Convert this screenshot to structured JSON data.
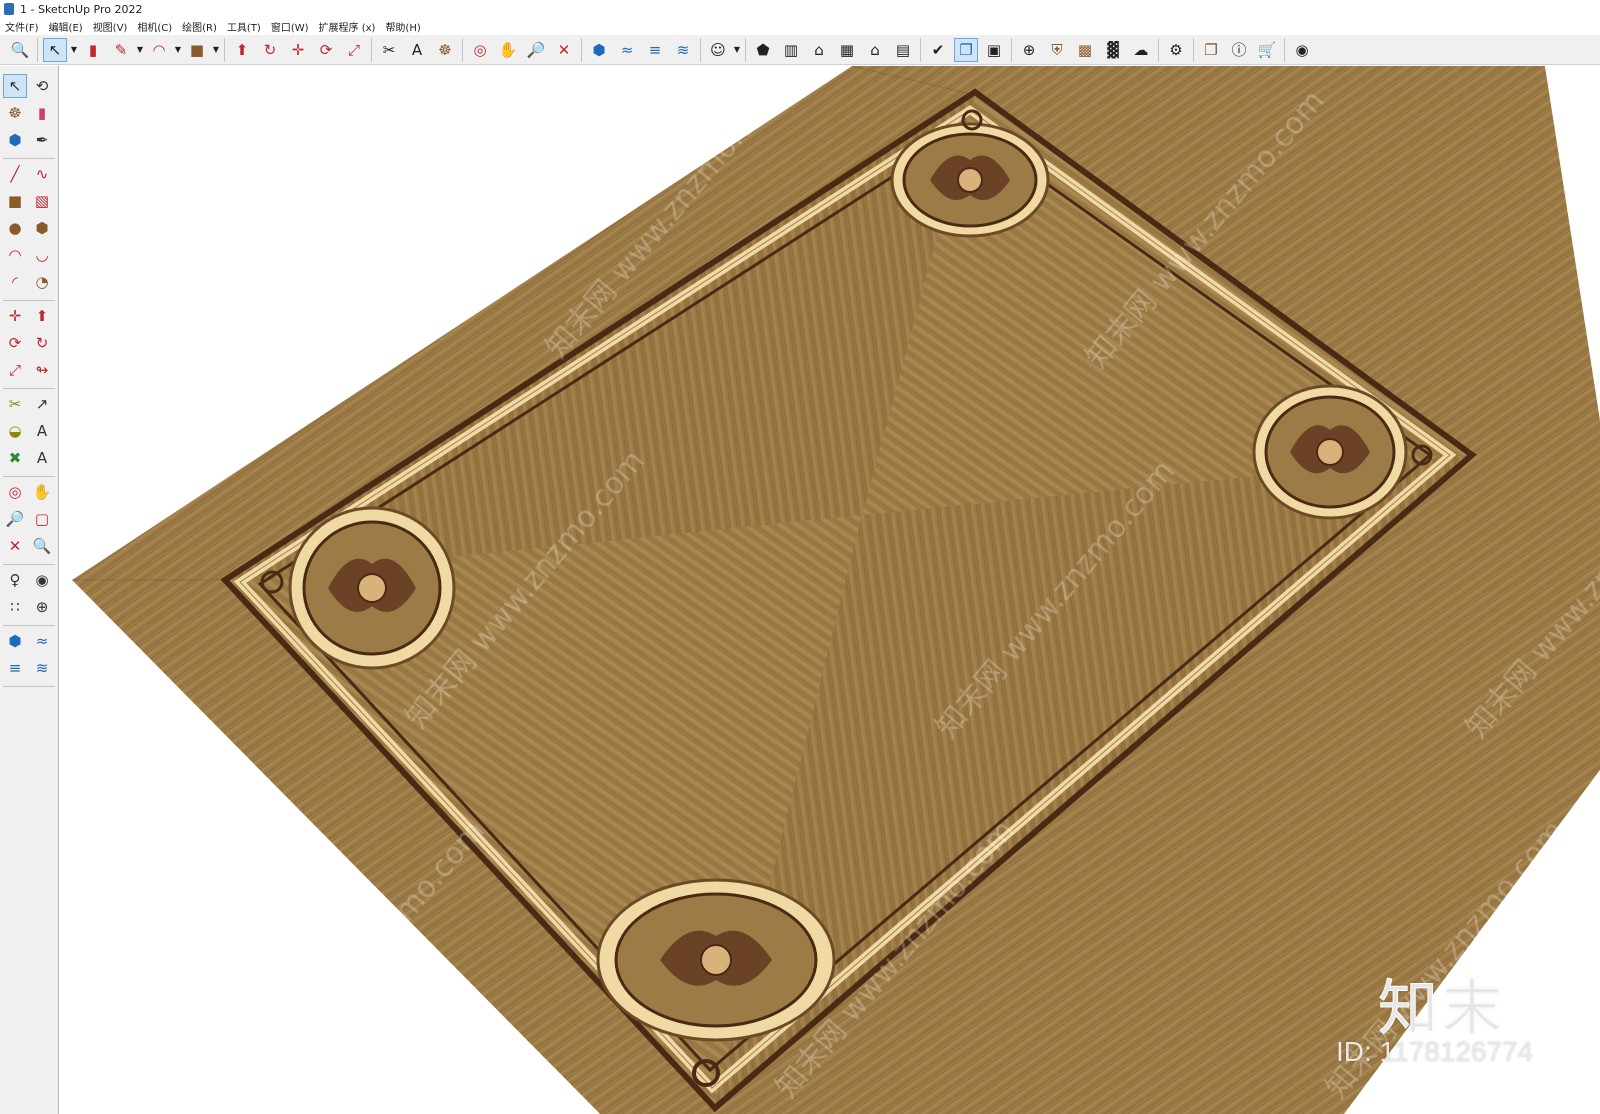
{
  "window": {
    "title": "1 - SketchUp Pro 2022"
  },
  "menu": [
    "文件(F)",
    "编辑(E)",
    "视图(V)",
    "相机(C)",
    "绘图(R)",
    "工具(T)",
    "窗口(W)",
    "扩展程序 (x)",
    "帮助(H)"
  ],
  "toolbar": {
    "icons": [
      "zoom-extents-icon",
      "select-icon",
      "eraser-icon",
      "pencil-icon",
      "arc-icon",
      "shape-icon",
      "push-pull-icon",
      "follow-me-icon",
      "move-icon",
      "rotate-icon",
      "scale-icon",
      "tape-measure-icon",
      "text-icon",
      "paint-bucket-icon",
      "orbit-icon",
      "pan-icon",
      "zoom-icon",
      "zoom-window-icon",
      "warehouse-icon",
      "section-icon",
      "tags-icon",
      "styles-icon",
      "account-icon",
      "iso-view-icon",
      "front-view-icon",
      "home-view-icon",
      "right-view-icon",
      "back-view-icon",
      "left-view-icon",
      "solid-tools-icon",
      "outer-shell-icon",
      "intersect-icon",
      "add-location-icon",
      "sandbox-icon",
      "photo-match-icon",
      "shadow-icon",
      "fog-icon",
      "extension-warehouse-icon",
      "extension-manager-icon",
      "cart-icon",
      "profile-icon"
    ]
  },
  "watermark": {
    "logo": "知末",
    "id": "ID: 1178126774",
    "diagonal": "知末网 www.znzmo.com"
  },
  "colors": {
    "wood_base": "#9c7a45",
    "wood_light": "#b08d55",
    "wood_dark": "#7d5f33",
    "inlay_dark": "#4a2a14",
    "inlay_light": "#f0d9a2",
    "accent_select": "#cfe4f7"
  }
}
